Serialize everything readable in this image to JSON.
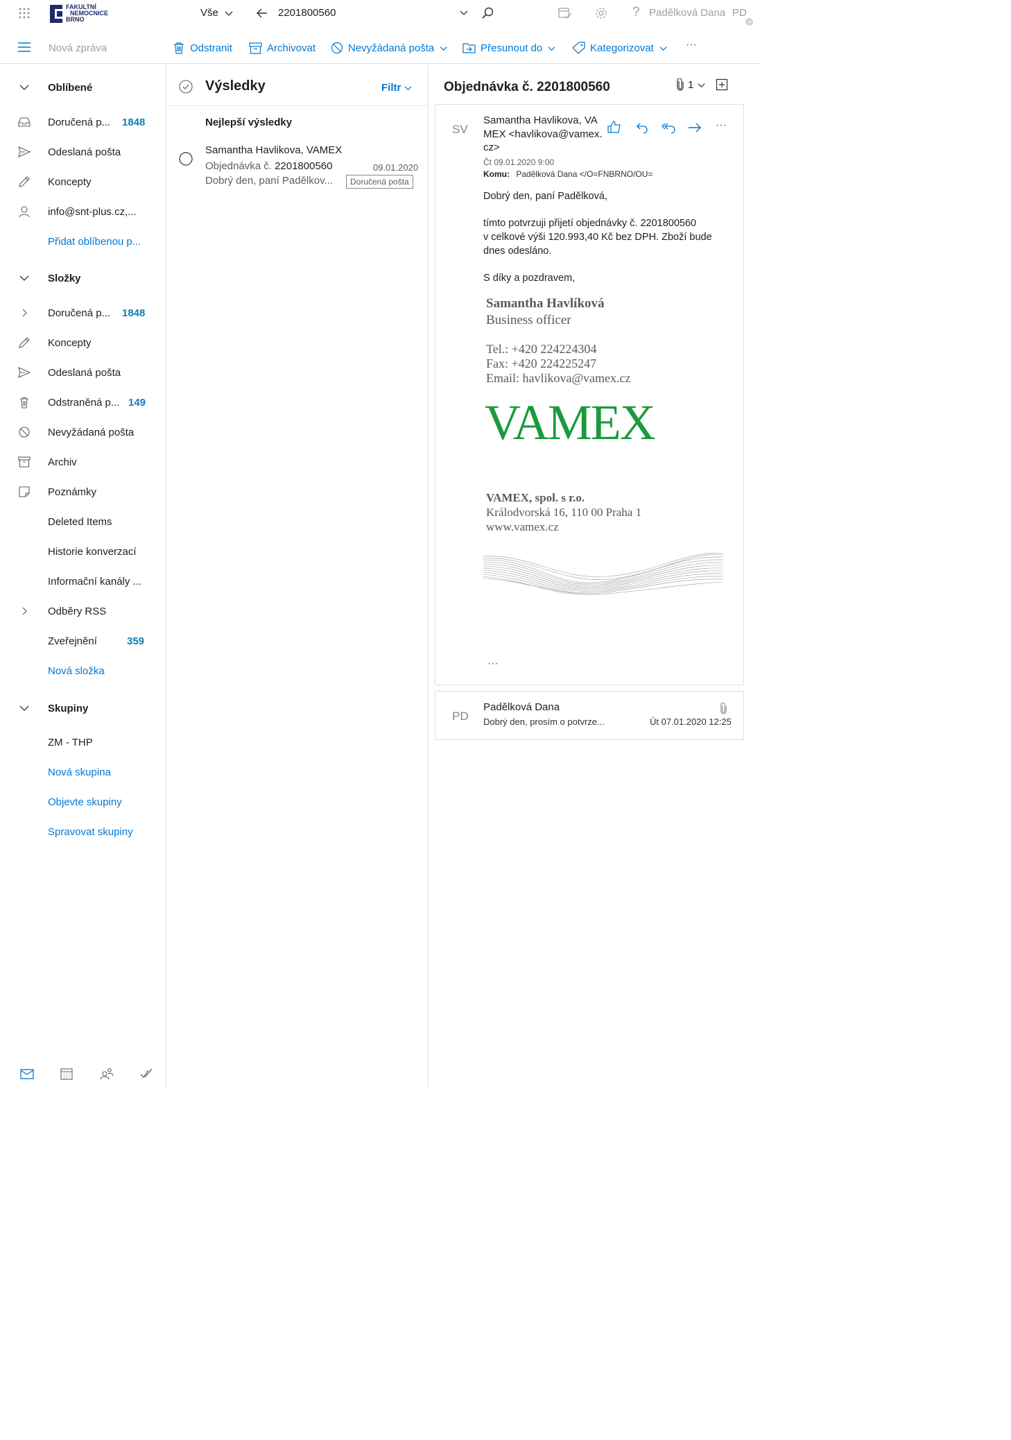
{
  "app": {
    "org_logo_lines": [
      "FAKULTNÍ",
      "NEMOCNICE",
      "BRNO"
    ],
    "scope_label": "Vše",
    "search_query": "2201800560",
    "user_name": "Padělková Dana",
    "user_initials": "PD"
  },
  "toolbar": {
    "new_message": "Nová zpráva",
    "delete": "Odstranit",
    "archive": "Archivovat",
    "junk": "Nevyžádaná pošta",
    "move_to": "Přesunout do",
    "categorize": "Kategorizovat",
    "more": "···"
  },
  "nav": {
    "favorites": {
      "header": "Oblíbené",
      "items": [
        {
          "label": "Doručená p...",
          "count": "1848",
          "icon": "inbox-icon"
        },
        {
          "label": "Odeslaná pošta",
          "count": "",
          "icon": "send-icon"
        },
        {
          "label": "Koncepty",
          "count": "",
          "icon": "pencil-icon"
        },
        {
          "label": "info@snt-plus.cz,...",
          "count": "",
          "icon": "person-icon"
        }
      ],
      "add_link": "Přidat oblíbenou p..."
    },
    "folders": {
      "header": "Složky",
      "items": [
        {
          "label": "Doručená p...",
          "count": "1848",
          "icon": "chevron-right-icon"
        },
        {
          "label": "Koncepty",
          "count": "",
          "icon": "pencil-icon"
        },
        {
          "label": "Odeslaná pošta",
          "count": "",
          "icon": "send-icon"
        },
        {
          "label": "Odstraněná p...",
          "count": "149",
          "icon": "trash-icon"
        },
        {
          "label": "Nevyžádaná pošta",
          "count": "",
          "icon": "block-icon"
        },
        {
          "label": "Archiv",
          "count": "",
          "icon": "archive-icon"
        },
        {
          "label": "Poznámky",
          "count": "",
          "icon": "note-icon"
        },
        {
          "label": "Deleted Items",
          "count": "",
          "icon": ""
        },
        {
          "label": "Historie konverzací",
          "count": "",
          "icon": ""
        },
        {
          "label": "Informační kanály ...",
          "count": "",
          "icon": ""
        },
        {
          "label": "Odběry RSS",
          "count": "",
          "icon": "chevron-right-icon"
        },
        {
          "label": "Zveřejnění",
          "count": "359",
          "icon": ""
        }
      ],
      "new_folder": "Nová složka"
    },
    "groups": {
      "header": "Skupiny",
      "items": [
        {
          "label": "ZM - THP"
        }
      ],
      "links": [
        "Nová skupina",
        "Objevte skupiny",
        "Spravovat skupiny"
      ]
    }
  },
  "list": {
    "title": "Výsledky",
    "filter": "Filtr",
    "section": "Nejlepší výsledky",
    "messages": [
      {
        "sender": "Samantha Havlikova, VAMEX",
        "subject_prefix": "Objednávka č. ",
        "subject_number": "2201800560",
        "date": "09.01.2020",
        "preview": "Dobrý den, paní Padělkov...",
        "folder_tag": "Doručená pošta"
      }
    ]
  },
  "reading": {
    "subject": "Objednávka č. 2201800560",
    "attachment_count": "1",
    "message": {
      "initials": "SV",
      "from_lines": [
        "Samantha Havlikova, VA",
        "MEX <havlikova@vamex.",
        "cz>"
      ],
      "date": "Čt 09.01.2020 9:00",
      "to_label": "Komu:",
      "to_value": "Padělková Dana </O=FNBRNO/OU=",
      "greeting": "Dobrý den, paní Padělková,",
      "body_lines": [
        "tímto potvrzuji přijetí objednávky č. 2201800560",
        "v celkové výši 120.993,40 Kč bez DPH. Zboží bude",
        "dnes odesláno."
      ],
      "closing": "S díky a pozdravem,",
      "signature": {
        "name": "Samantha Havlíková",
        "title": "Business officer",
        "tel": "Tel.: +420 224224304",
        "fax": "Fax: +420 224225247",
        "email": "Email:  havlikova@vamex.cz",
        "logo": "VAMEX",
        "company": "VAMEX, spol. s r.o.",
        "address": "Králodvorská 16, 110 00 Praha 1",
        "web": "www.vamex.cz"
      },
      "more": "···"
    },
    "previous": {
      "initials": "PD",
      "sender": "Padělková Dana",
      "preview": "Dobrý den, prosím o potvrze...",
      "date": "Út 07.01.2020 12:25"
    }
  },
  "colors": {
    "accent": "#0078d4",
    "count": "#0f7fb0",
    "logo_green": "#1a9a3c",
    "org_navy": "#1f2a6b"
  }
}
